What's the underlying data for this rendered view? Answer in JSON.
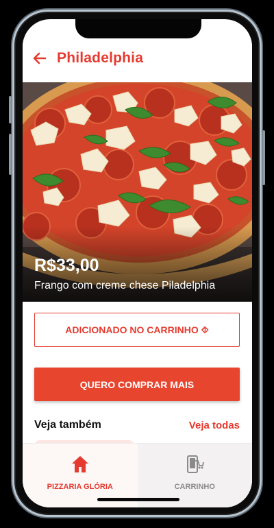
{
  "header": {
    "title": "Philadelphia"
  },
  "product": {
    "price": "R$33,00",
    "description": "Frango com creme chese Piladelphia"
  },
  "actions": {
    "added_label": "ADICIONADO NO CARRINHO ⯑",
    "buy_more_label": "QUERO COMPRAR MAIS"
  },
  "related": {
    "title": "Veja também",
    "see_all": "Veja todas"
  },
  "tabs": [
    {
      "label": "PIZZARIA GLÓRIA",
      "icon": "home-icon",
      "active": true
    },
    {
      "label": "CARRINHO",
      "icon": "cart-icon",
      "active": false
    }
  ],
  "colors": {
    "accent": "#e53a2f",
    "button": "#e8452f"
  }
}
